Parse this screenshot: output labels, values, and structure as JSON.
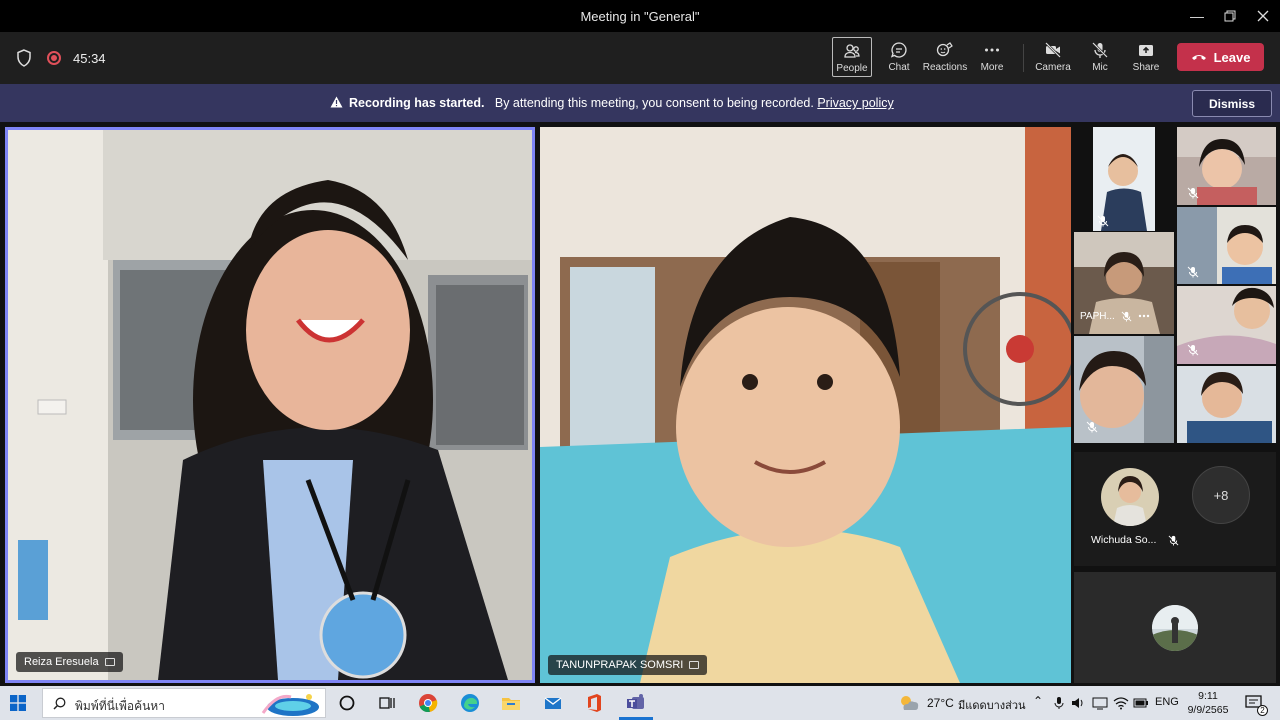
{
  "window": {
    "title": "Meeting in \"General\""
  },
  "toolbar": {
    "timer": "45:34",
    "buttons": [
      {
        "label": "People",
        "icon": "people-icon"
      },
      {
        "label": "Chat",
        "icon": "chat-icon"
      },
      {
        "label": "Reactions",
        "icon": "reactions-icon"
      },
      {
        "label": "More",
        "icon": "more-icon"
      },
      {
        "label": "Camera",
        "icon": "camera-off-icon"
      },
      {
        "label": "Mic",
        "icon": "mic-off-icon"
      },
      {
        "label": "Share",
        "icon": "share-icon"
      }
    ],
    "leave_label": "Leave"
  },
  "banner": {
    "title": "Recording has started.",
    "text": "By attending this meeting, you consent to being recorded.",
    "link": "Privacy policy",
    "dismiss_label": "Dismiss"
  },
  "participants": {
    "main": [
      {
        "name": "Reiza Eresuela"
      },
      {
        "name": "TANUNPRAPAK SOMSRI"
      }
    ],
    "gallery_label": "PAPH...",
    "audio_only": {
      "name": "Wichuda So..."
    },
    "overflow": "+8"
  },
  "taskbar": {
    "search_placeholder": "พิมพ์ที่นี่เพื่อค้นหา",
    "weather": "27°C",
    "weather_text": "มีแดดบางส่วน",
    "lang": "ENG",
    "time": "9:11",
    "date": "9/9/2565",
    "notification_count": "2"
  },
  "colors": {
    "leave": "#c4314b",
    "banner": "#35365f",
    "active_speaker": "#7f85f5",
    "recording": "#e0505a"
  }
}
